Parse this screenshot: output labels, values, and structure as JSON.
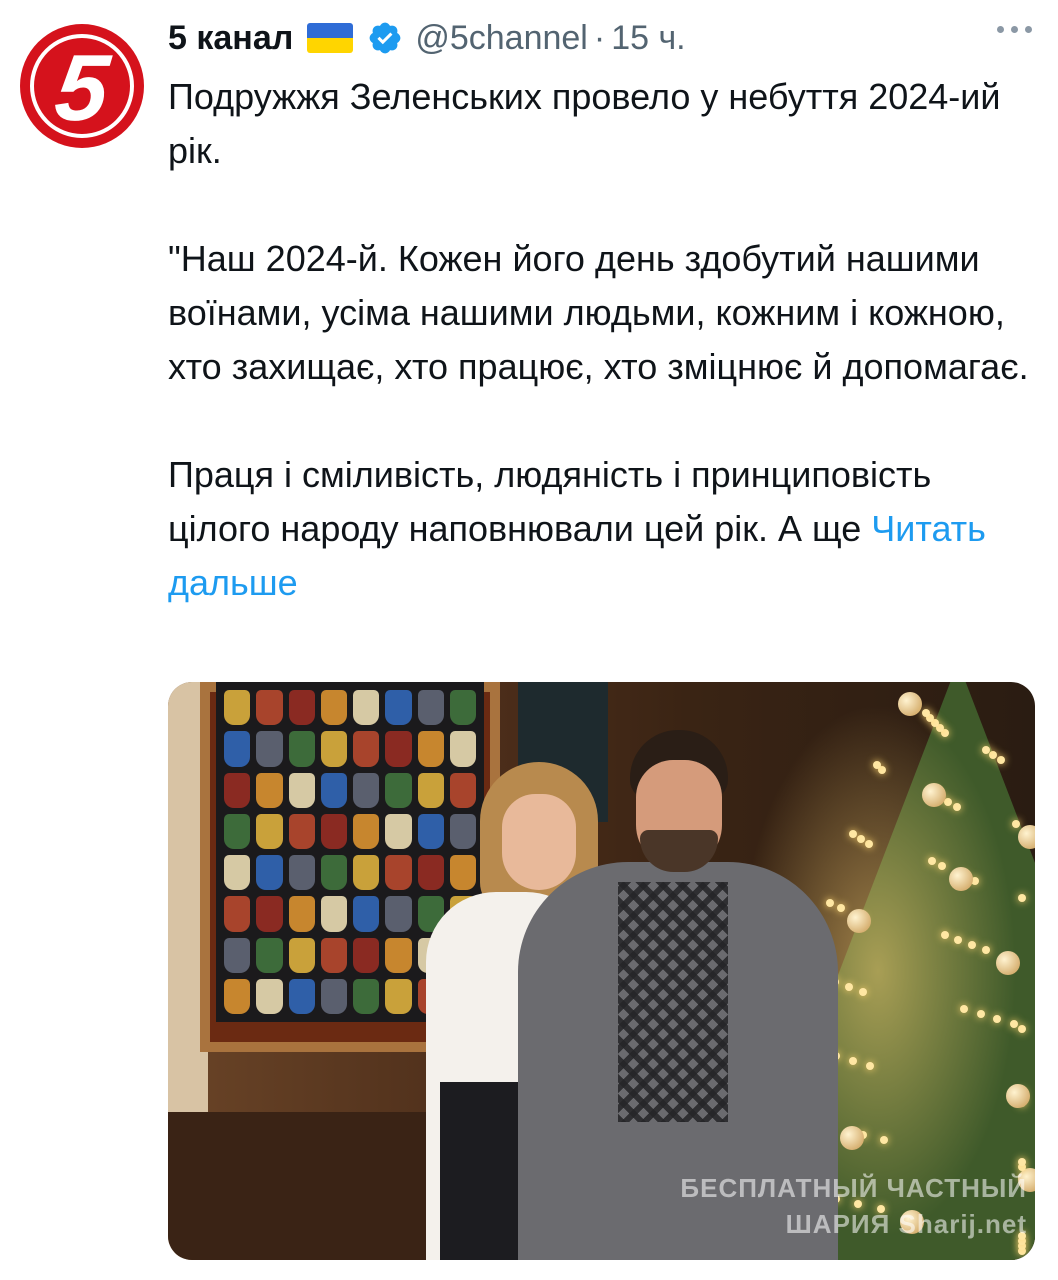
{
  "author": {
    "avatar_text": "5",
    "display_name": "5 канал",
    "flag_colors": {
      "top": "#2f6cd6",
      "bottom": "#ffd500"
    },
    "verified_icon": "verified-badge-icon",
    "verified_color": "#1d9bf0",
    "handle": "@5channel",
    "separator": "·",
    "timestamp": "15 ч."
  },
  "more_icon": "more-horizontal-icon",
  "tweet": {
    "paragraph_1": "Подружжя Зеленських провело у небуття 2024-ий рік.",
    "paragraph_2": "\"Наш 2024-й. Кожен його день здобутий нашими воїнами, усіма нашими людьми, кожним і кожною, хто захищає, хто працює, хто зміцнює й допомагає.",
    "paragraph_3": "Праця і сміливість, людяність і принциповість цілого народу наповнювали цей рік. А ще",
    "read_more": "Читать дальше"
  },
  "media": {
    "watermark_line_1": "БЕСПЛАТНЫЙ ЧАСТНЫЙ",
    "watermark_line_2": "ШАРИЯ  Sharij.net"
  },
  "colors": {
    "text": "#0f1419",
    "secondary": "#536471",
    "link": "#1d9bf0",
    "avatar_bg": "#d5121c"
  }
}
